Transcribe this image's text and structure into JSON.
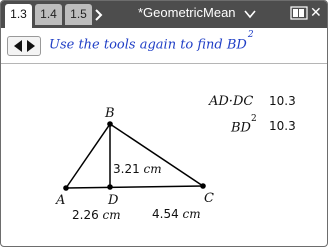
{
  "tabs": [
    {
      "label": "1.3",
      "active": true
    },
    {
      "label": "1.4",
      "active": false
    },
    {
      "label": "1.5",
      "active": false
    }
  ],
  "tab_scroll_icon": "chevron-right-icon",
  "document_title": "*GeometricMean",
  "status_icons": [
    "battery-icon",
    "close-icon"
  ],
  "navigator_icons": [
    "left-arrow-icon",
    "right-arrow-icon"
  ],
  "prompt": {
    "text": "Use the tools again to find BD",
    "exponent": "2"
  },
  "calculations": [
    {
      "label": "AD·DC",
      "value": "10.3"
    },
    {
      "label": "BD",
      "exponent": "2",
      "value": "10.3"
    }
  ],
  "triangle": {
    "points": {
      "A": "A",
      "B": "B",
      "C": "C",
      "D": "D"
    },
    "measurements": {
      "BD": "3.21",
      "AD": "2.26",
      "DC": "4.54",
      "unit": "cm"
    }
  },
  "colors": {
    "topbar": "#4d4d4d",
    "prompt": "#1f3ec6",
    "active_tab": "#ffffff"
  }
}
